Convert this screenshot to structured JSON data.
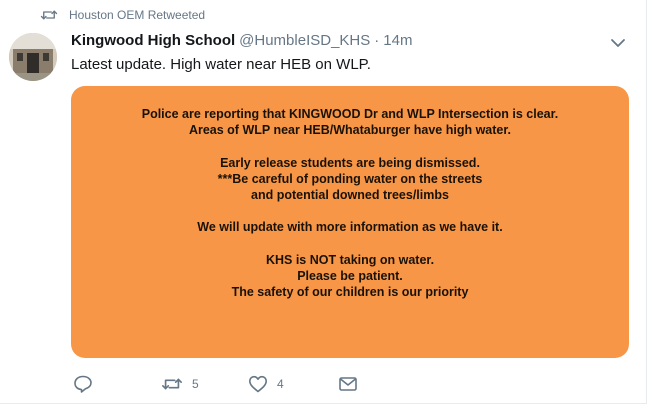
{
  "retweet_context": {
    "text": "Houston OEM Retweeted",
    "icon": "retweet-icon"
  },
  "tweet": {
    "author_name": "Kingwood High School",
    "author_handle": "@HumbleISD_KHS",
    "separator": "·",
    "time": "14m",
    "text": "Latest update. High water near HEB on WLP.",
    "image": {
      "background": "#f79646",
      "lines": [
        "Police are reporting that KINGWOOD Dr and WLP Intersection is clear.",
        "Areas of WLP near HEB/Whataburger have high water.",
        "",
        "Early release students are being dismissed.",
        "***Be careful of ponding water on the streets",
        "and potential downed trees/limbs",
        "",
        "We will update with more information as we have it.",
        "",
        "KHS is NOT taking on water.",
        "Please be patient.",
        "The safety of our children is our priority"
      ]
    }
  },
  "actions": {
    "reply": {
      "icon": "reply-icon"
    },
    "retweet": {
      "icon": "retweet-icon",
      "count": "5"
    },
    "like": {
      "icon": "heart-icon",
      "count": "4"
    },
    "message": {
      "icon": "envelope-icon"
    }
  },
  "colors": {
    "accent_gray": "#657786",
    "media_orange": "#f79646",
    "text": "#14171a"
  }
}
